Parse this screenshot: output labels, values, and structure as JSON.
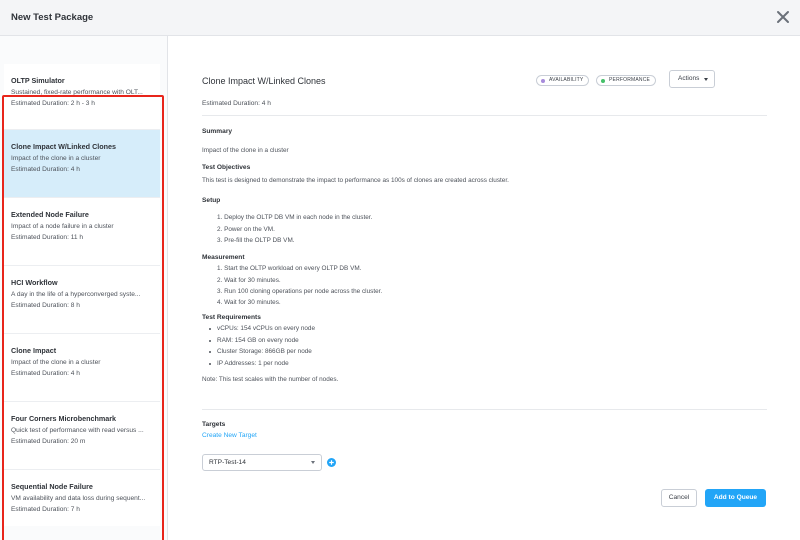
{
  "header": {
    "title": "New Test Package"
  },
  "sidebar": {
    "items": [
      {
        "name": "OLTP Simulator",
        "desc": "Sustained, fixed-rate performance with OLT...",
        "duration": "Estimated Duration: 2 h - 3 h",
        "selected": false
      },
      {
        "name": "Clone Impact W/Linked Clones",
        "desc": "Impact of the clone in a cluster",
        "duration": "Estimated Duration: 4 h",
        "selected": true
      },
      {
        "name": "Extended Node Failure",
        "desc": "Impact of a node failure in a cluster",
        "duration": "Estimated Duration: 11 h",
        "selected": false
      },
      {
        "name": "HCI Workflow",
        "desc": "A day in the life of a hyperconverged syste...",
        "duration": "Estimated Duration: 8 h",
        "selected": false
      },
      {
        "name": "Clone Impact",
        "desc": "Impact of the clone in a cluster",
        "duration": "Estimated Duration: 4 h",
        "selected": false
      },
      {
        "name": "Four Corners Microbenchmark",
        "desc": "Quick test of performance with read versus ...",
        "duration": "Estimated Duration: 20 m",
        "selected": false
      },
      {
        "name": "Sequential Node Failure",
        "desc": "VM availability and data loss during sequent...",
        "duration": "Estimated Duration: 7 h",
        "selected": false
      }
    ]
  },
  "detail": {
    "title": "Clone Impact W/Linked Clones",
    "badges": [
      {
        "label": "AVAILABILITY",
        "color": "#a78bdb"
      },
      {
        "label": "PERFORMANCE",
        "color": "#46c06a"
      }
    ],
    "actions_label": "Actions",
    "estimated_duration": "Estimated Duration: 4 h",
    "summary_title": "Summary",
    "summary_text": "Impact of the clone in a cluster",
    "objectives_title": "Test Objectives",
    "objectives_text": "This test is designed to demonstrate the impact to performance as 100s of clones are created across cluster.",
    "setup_title": "Setup",
    "setup_steps": [
      "1. Deploy the OLTP DB VM in each node in the cluster.",
      "2. Power on the VM.",
      "3. Pre-fill the OLTP DB VM."
    ],
    "measurement_title": "Measurement",
    "measurement_steps": [
      "1. Start the OLTP workload on every OLTP DB VM.",
      "2. Wait for 30 minutes.",
      "3. Run 100 cloning operations per node across the cluster.",
      "4. Wait for 30 minutes."
    ],
    "requirements_title": "Test Requirements",
    "requirements": [
      "vCPUs: 154 vCPUs on every node",
      "RAM: 154 GB on every node",
      "Cluster Storage: 866GB per node",
      "IP Addresses: 1 per node"
    ],
    "note": "Note: This test scales with the number of nodes."
  },
  "targets": {
    "title": "Targets",
    "create_link": "Create New Target",
    "selected_target": "RTP-Test-14"
  },
  "footer": {
    "cancel_label": "Cancel",
    "queue_label": "Add to Queue"
  },
  "colors": {
    "accent": "#22a5f7",
    "selected_bg": "#d6edfa",
    "highlight_border": "#e8251b"
  }
}
